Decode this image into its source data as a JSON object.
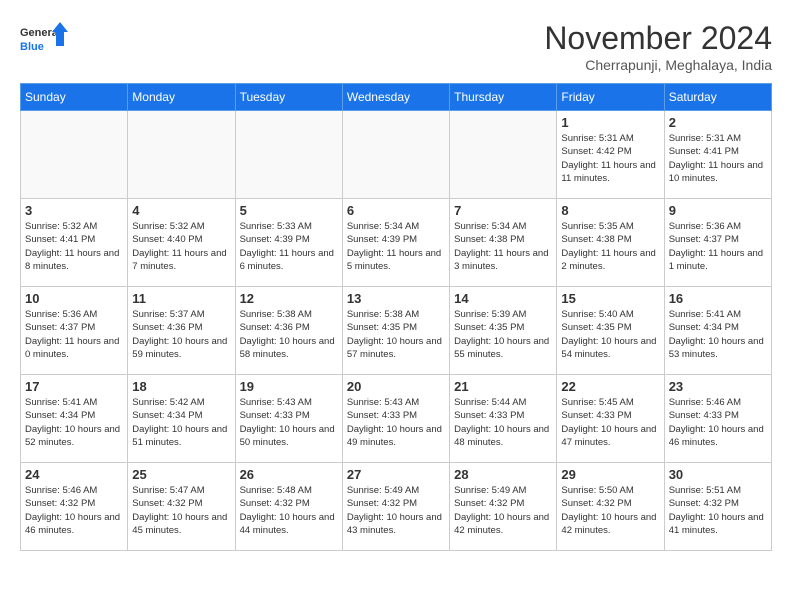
{
  "logo": {
    "text_general": "General",
    "text_blue": "Blue"
  },
  "title": "November 2024",
  "subtitle": "Cherrapunji, Meghalaya, India",
  "weekdays": [
    "Sunday",
    "Monday",
    "Tuesday",
    "Wednesday",
    "Thursday",
    "Friday",
    "Saturday"
  ],
  "weeks": [
    [
      {
        "day": "",
        "empty": true
      },
      {
        "day": "",
        "empty": true
      },
      {
        "day": "",
        "empty": true
      },
      {
        "day": "",
        "empty": true
      },
      {
        "day": "",
        "empty": true
      },
      {
        "day": "1",
        "sunrise": "5:31 AM",
        "sunset": "4:42 PM",
        "daylight": "11 hours and 11 minutes."
      },
      {
        "day": "2",
        "sunrise": "5:31 AM",
        "sunset": "4:41 PM",
        "daylight": "11 hours and 10 minutes."
      }
    ],
    [
      {
        "day": "3",
        "sunrise": "5:32 AM",
        "sunset": "4:41 PM",
        "daylight": "11 hours and 8 minutes."
      },
      {
        "day": "4",
        "sunrise": "5:32 AM",
        "sunset": "4:40 PM",
        "daylight": "11 hours and 7 minutes."
      },
      {
        "day": "5",
        "sunrise": "5:33 AM",
        "sunset": "4:39 PM",
        "daylight": "11 hours and 6 minutes."
      },
      {
        "day": "6",
        "sunrise": "5:34 AM",
        "sunset": "4:39 PM",
        "daylight": "11 hours and 5 minutes."
      },
      {
        "day": "7",
        "sunrise": "5:34 AM",
        "sunset": "4:38 PM",
        "daylight": "11 hours and 3 minutes."
      },
      {
        "day": "8",
        "sunrise": "5:35 AM",
        "sunset": "4:38 PM",
        "daylight": "11 hours and 2 minutes."
      },
      {
        "day": "9",
        "sunrise": "5:36 AM",
        "sunset": "4:37 PM",
        "daylight": "11 hours and 1 minute."
      }
    ],
    [
      {
        "day": "10",
        "sunrise": "5:36 AM",
        "sunset": "4:37 PM",
        "daylight": "11 hours and 0 minutes."
      },
      {
        "day": "11",
        "sunrise": "5:37 AM",
        "sunset": "4:36 PM",
        "daylight": "10 hours and 59 minutes."
      },
      {
        "day": "12",
        "sunrise": "5:38 AM",
        "sunset": "4:36 PM",
        "daylight": "10 hours and 58 minutes."
      },
      {
        "day": "13",
        "sunrise": "5:38 AM",
        "sunset": "4:35 PM",
        "daylight": "10 hours and 57 minutes."
      },
      {
        "day": "14",
        "sunrise": "5:39 AM",
        "sunset": "4:35 PM",
        "daylight": "10 hours and 55 minutes."
      },
      {
        "day": "15",
        "sunrise": "5:40 AM",
        "sunset": "4:35 PM",
        "daylight": "10 hours and 54 minutes."
      },
      {
        "day": "16",
        "sunrise": "5:41 AM",
        "sunset": "4:34 PM",
        "daylight": "10 hours and 53 minutes."
      }
    ],
    [
      {
        "day": "17",
        "sunrise": "5:41 AM",
        "sunset": "4:34 PM",
        "daylight": "10 hours and 52 minutes."
      },
      {
        "day": "18",
        "sunrise": "5:42 AM",
        "sunset": "4:34 PM",
        "daylight": "10 hours and 51 minutes."
      },
      {
        "day": "19",
        "sunrise": "5:43 AM",
        "sunset": "4:33 PM",
        "daylight": "10 hours and 50 minutes."
      },
      {
        "day": "20",
        "sunrise": "5:43 AM",
        "sunset": "4:33 PM",
        "daylight": "10 hours and 49 minutes."
      },
      {
        "day": "21",
        "sunrise": "5:44 AM",
        "sunset": "4:33 PM",
        "daylight": "10 hours and 48 minutes."
      },
      {
        "day": "22",
        "sunrise": "5:45 AM",
        "sunset": "4:33 PM",
        "daylight": "10 hours and 47 minutes."
      },
      {
        "day": "23",
        "sunrise": "5:46 AM",
        "sunset": "4:33 PM",
        "daylight": "10 hours and 46 minutes."
      }
    ],
    [
      {
        "day": "24",
        "sunrise": "5:46 AM",
        "sunset": "4:32 PM",
        "daylight": "10 hours and 46 minutes."
      },
      {
        "day": "25",
        "sunrise": "5:47 AM",
        "sunset": "4:32 PM",
        "daylight": "10 hours and 45 minutes."
      },
      {
        "day": "26",
        "sunrise": "5:48 AM",
        "sunset": "4:32 PM",
        "daylight": "10 hours and 44 minutes."
      },
      {
        "day": "27",
        "sunrise": "5:49 AM",
        "sunset": "4:32 PM",
        "daylight": "10 hours and 43 minutes."
      },
      {
        "day": "28",
        "sunrise": "5:49 AM",
        "sunset": "4:32 PM",
        "daylight": "10 hours and 42 minutes."
      },
      {
        "day": "29",
        "sunrise": "5:50 AM",
        "sunset": "4:32 PM",
        "daylight": "10 hours and 42 minutes."
      },
      {
        "day": "30",
        "sunrise": "5:51 AM",
        "sunset": "4:32 PM",
        "daylight": "10 hours and 41 minutes."
      }
    ]
  ]
}
